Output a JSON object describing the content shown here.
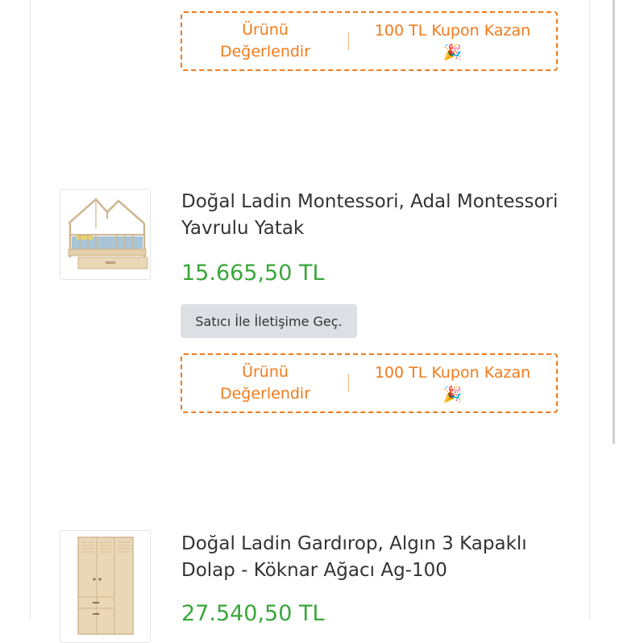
{
  "items": [
    {
      "review_label_line1": "Ürünü",
      "review_label_line2": "Değerlendir",
      "coupon_label": "100 TL Kupon Kazan",
      "coupon_emoji": "🎉"
    },
    {
      "title": "Doğal Ladin Montessori, Adal Montessori Yavrulu Yatak",
      "price": "15.665,50 TL",
      "contact_label": "Satıcı İle İletişime Geç.",
      "review_label_line1": "Ürünü",
      "review_label_line2": "Değerlendir",
      "coupon_label": "100 TL Kupon Kazan",
      "coupon_emoji": "🎉"
    },
    {
      "title": "Doğal Ladin Gardırop, Algın 3 Kapaklı Dolap - Köknar Ağacı Ag-100",
      "price": "27.540,50 TL"
    }
  ],
  "colors": {
    "accent_orange": "#f27a1a",
    "price_green": "#3aa63a"
  },
  "icons": {
    "product_1_image": "montessori-house-bed-image",
    "product_2_image": "wardrobe-image"
  }
}
